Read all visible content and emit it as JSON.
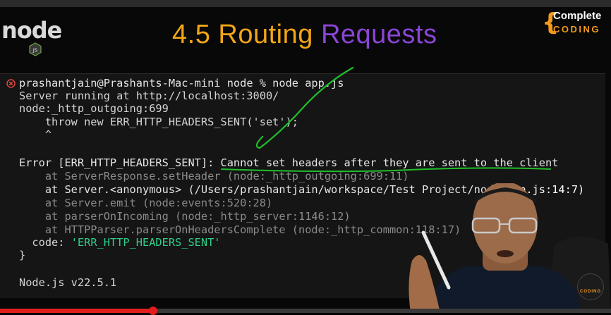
{
  "slide": {
    "title_part1": "4.5 Routing",
    "title_part2": "Requests",
    "logo_text": "node",
    "logo_badge": "JS",
    "brand_line1": "Complete",
    "brand_line2": "CODING",
    "small_badge_text": "CODING"
  },
  "terminal": {
    "lines": [
      "prashantjain@Prashants-Mac-mini node % node app.js",
      "Server running at http://localhost:3000/",
      "node:_http_outgoing:699",
      "    throw new ERR_HTTP_HEADERS_SENT('set');",
      "    ^",
      "Error [ERR_HTTP_HEADERS_SENT]: Cannot set headers after they are sent to the client",
      "    at ServerResponse.setHeader (node:_http_outgoing:699:11)",
      "    at Server.<anonymous> (/Users/prashantjain/workspace/Test Project/node/",
      "app.js:14:7)",
      "    at Server.emit (node:events:520:28)",
      "    at parserOnIncoming (node:_http_server:1146:12)",
      "    at HTTPParser.parserOnHeadersComplete (node:_http_common:118:17)",
      "  code: ",
      "'ERR_HTTP_HEADERS_SENT'",
      "}",
      "Node.js v22.5.1"
    ]
  },
  "video": {
    "progress_fraction": 0.25
  },
  "colors": {
    "title_orange": "#f2a516",
    "title_purple": "#8b45d6",
    "error_red": "#e0443e",
    "string_green": "#2ecf8a",
    "annotation_green": "#1fbf2a",
    "progress_red": "#e01e1e"
  },
  "icons": {
    "error": "error-circle-icon",
    "presenter": "presenter-video",
    "chair": "chair-icon"
  }
}
